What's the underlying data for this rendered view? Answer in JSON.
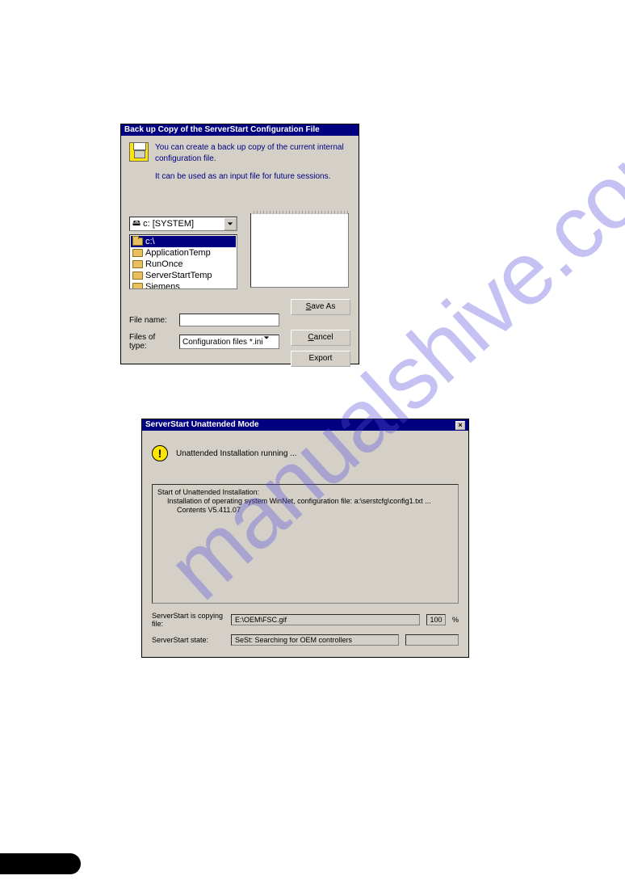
{
  "watermark": "manualshive.com",
  "dialog1": {
    "title": "Back up Copy of the ServerStart Configuration File",
    "intro_line1": "You can create a back up copy of the current internal configuration file.",
    "intro_line2": "It can be used as an input file for future sessions.",
    "drive_selected": "c: [SYSTEM]",
    "folders": [
      {
        "label": "c:\\",
        "selected": true
      },
      {
        "label": "ApplicationTemp",
        "selected": false
      },
      {
        "label": "RunOnce",
        "selected": false
      },
      {
        "label": "ServerStartTemp",
        "selected": false
      },
      {
        "label": "Siemens",
        "selected": false
      }
    ],
    "filename_label": "File name:",
    "filename_value": "",
    "type_label": "Files of type:",
    "type_value": "Configuration files *.ini",
    "btn_saveas": "Save As",
    "btn_saveas_key": "S",
    "btn_cancel": "Cancel",
    "btn_cancel_key": "C",
    "btn_export": "Export"
  },
  "dialog2": {
    "title": "ServerStart Unattended Mode",
    "status_text": "Unattended Installation running ...",
    "log_line1": "Start of Unattended Installation:",
    "log_line2": "Installation of operating system WinNet, configuration file: a:\\serstcfg\\config1.txt ...",
    "log_line3": "Contents V5.411.07",
    "copy_label": "ServerStart is copying file:",
    "copy_value": "E:\\OEM\\FSC.gif",
    "copy_pct": "100",
    "pct_sign": "%",
    "state_label": "ServerStart state:",
    "state_value": "SeSt: Searching for OEM controllers"
  }
}
